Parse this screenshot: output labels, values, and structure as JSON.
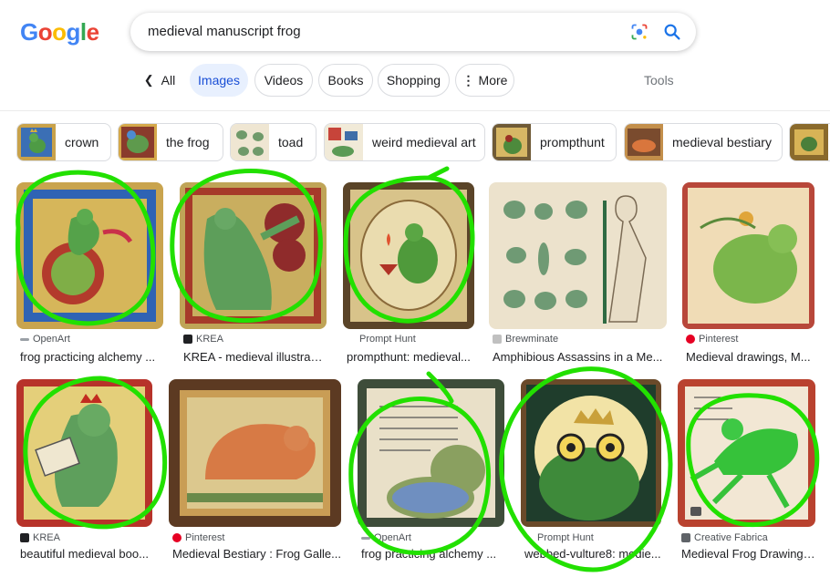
{
  "logo": {
    "letters": [
      "G",
      "o",
      "o",
      "g",
      "l",
      "e"
    ],
    "colors": [
      "#4285f4",
      "#ea4335",
      "#fbbc05",
      "#4285f4",
      "#34a853",
      "#ea4335"
    ]
  },
  "search": {
    "query": "medieval manuscript frog"
  },
  "tabs": {
    "back_label": "All",
    "items": [
      "Images",
      "Videos",
      "Books",
      "Shopping",
      "More"
    ],
    "active": "Images",
    "tools_label": "Tools"
  },
  "chips": [
    "crown",
    "the frog",
    "toad",
    "weird medieval art",
    "prompthunt",
    "medieval bestiary"
  ],
  "results": [
    {
      "source": "OpenArt",
      "title": "frog practicing alchemy ..."
    },
    {
      "source": "KREA",
      "title": "KREA - medieval illustrati..."
    },
    {
      "source": "Prompt Hunt",
      "title": "prompthunt: medieval..."
    },
    {
      "source": "Brewminate",
      "title": "Amphibious Assassins in a Me..."
    },
    {
      "source": "Pinterest",
      "title": "Medieval drawings, M..."
    },
    {
      "source": "KREA",
      "title": "beautiful medieval boo..."
    },
    {
      "source": "Pinterest",
      "title": "Medieval Bestiary : Frog Galle..."
    },
    {
      "source": "OpenArt",
      "title": "frog practicing alchemy ..."
    },
    {
      "source": "Prompt Hunt",
      "title": "webbed-vulture8: medie..."
    },
    {
      "source": "Creative Fabrica",
      "title": "Medieval Frog Drawing ..."
    }
  ],
  "colors": {
    "accent_blue": "#1a73e8",
    "annotation_green": "#22e000"
  }
}
